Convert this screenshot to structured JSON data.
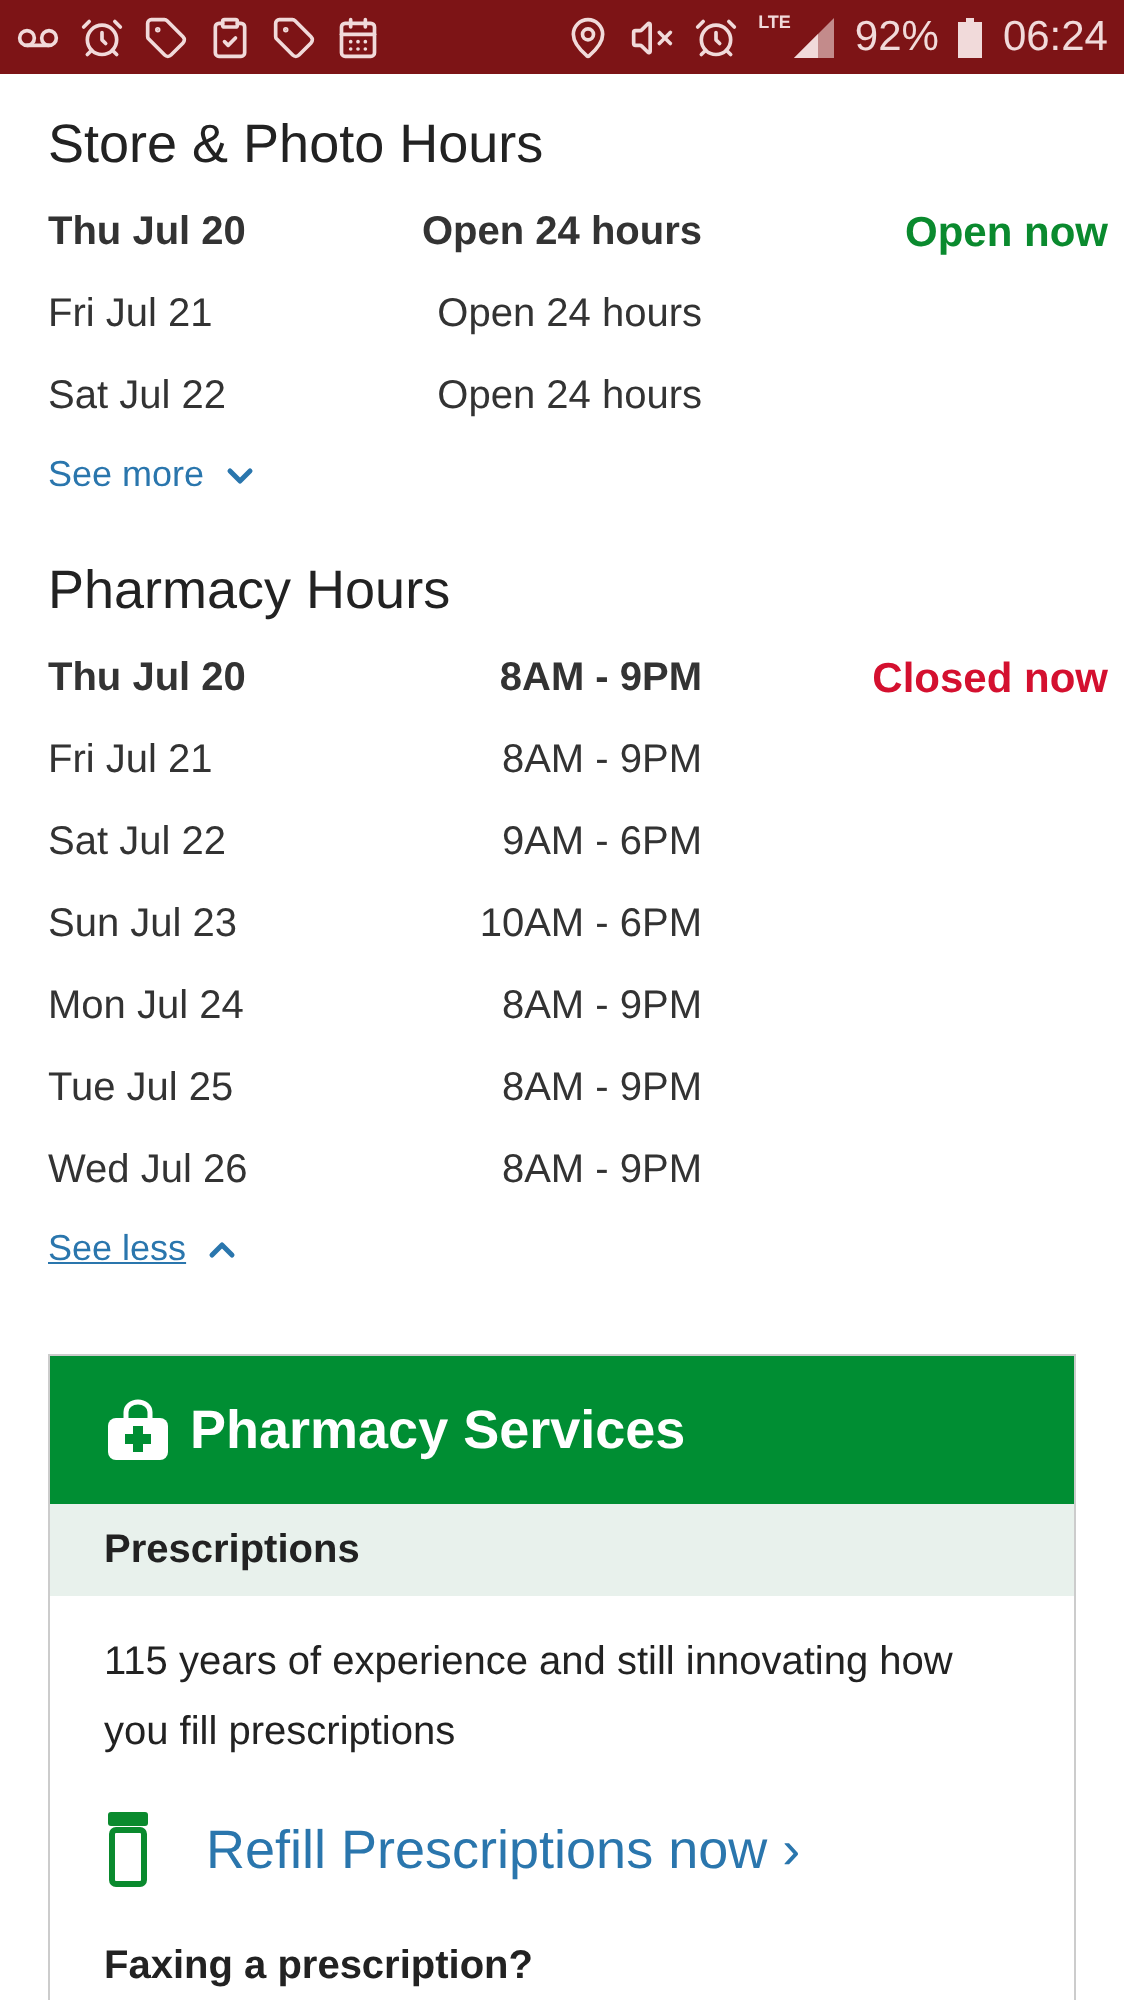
{
  "status_bar": {
    "network": "LTE",
    "battery": "92%",
    "time": "06:24"
  },
  "sections": [
    {
      "title": "Store & Photo Hours",
      "rows": [
        {
          "day": "Thu Jul 20",
          "hours": "Open 24 hours",
          "today": true,
          "status": {
            "text": "Open now",
            "kind": "open"
          }
        },
        {
          "day": "Fri Jul 21",
          "hours": "Open 24 hours",
          "today": false
        },
        {
          "day": "Sat Jul 22",
          "hours": "Open 24 hours",
          "today": false
        }
      ],
      "toggle": {
        "label": "See more",
        "expanded": false
      }
    },
    {
      "title": "Pharmacy Hours",
      "rows": [
        {
          "day": "Thu Jul 20",
          "hours": "8AM - 9PM",
          "today": true,
          "status": {
            "text": "Closed now",
            "kind": "closed"
          }
        },
        {
          "day": "Fri Jul 21",
          "hours": "8AM - 9PM",
          "today": false
        },
        {
          "day": "Sat Jul 22",
          "hours": "9AM - 6PM",
          "today": false
        },
        {
          "day": "Sun Jul 23",
          "hours": "10AM - 6PM",
          "today": false
        },
        {
          "day": "Mon Jul 24",
          "hours": "8AM - 9PM",
          "today": false
        },
        {
          "day": "Tue Jul 25",
          "hours": "8AM - 9PM",
          "today": false
        },
        {
          "day": "Wed Jul 26",
          "hours": "8AM - 9PM",
          "today": false
        }
      ],
      "toggle": {
        "label": "See less",
        "expanded": true
      }
    }
  ],
  "services": {
    "title": "Pharmacy Services",
    "subheading": "Prescriptions",
    "description": "115 years of experience and still innovating how you fill prescriptions",
    "link": "Refill Prescriptions now ›",
    "next_heading": "Faxing a prescription?"
  }
}
